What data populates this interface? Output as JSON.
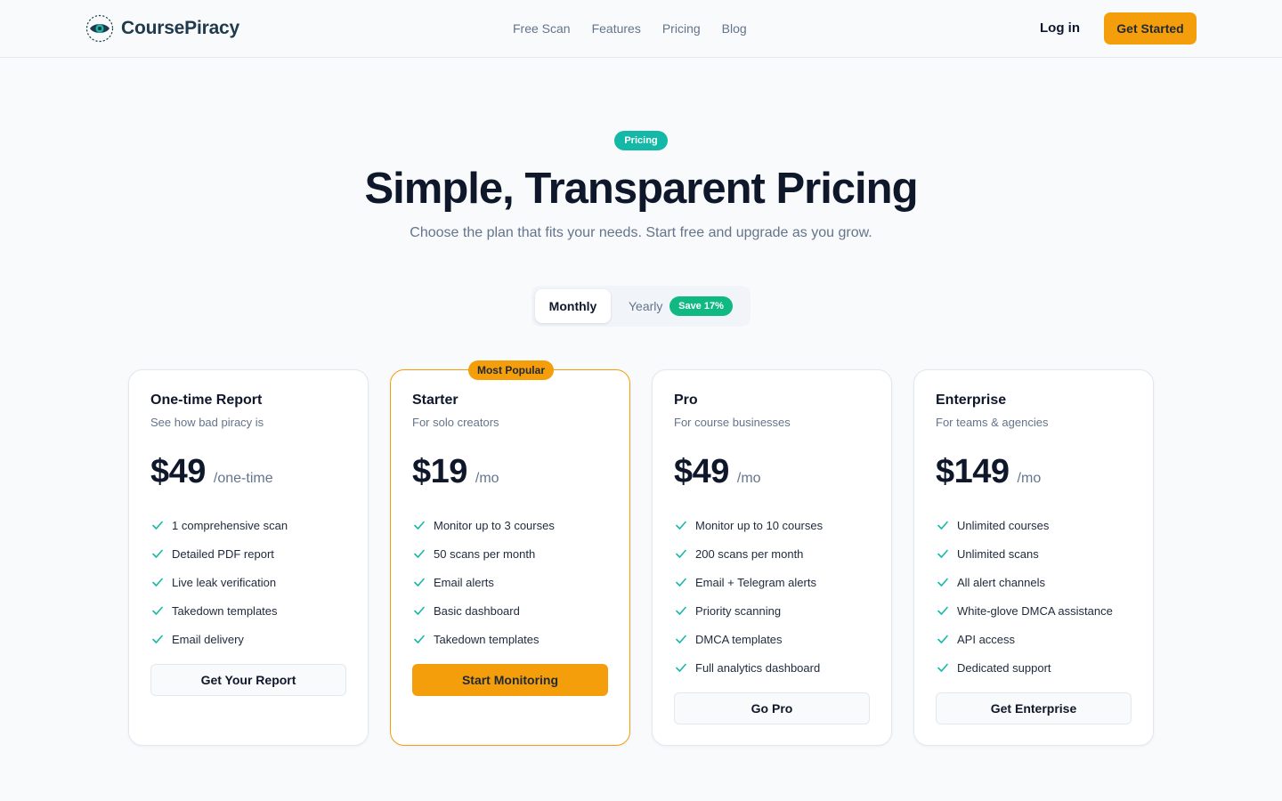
{
  "colors": {
    "accent": "#f59e0b",
    "teal": "#14b8a6",
    "success": "#10b981",
    "text": "#0f172a",
    "muted": "#64748b"
  },
  "header": {
    "brand": "CoursePiracy",
    "logo_icon": "eye-icon",
    "nav": [
      "Free Scan",
      "Features",
      "Pricing",
      "Blog"
    ],
    "login": "Log in",
    "cta": "Get Started"
  },
  "hero": {
    "pill": "Pricing",
    "title": "Simple, Transparent Pricing",
    "subtitle": "Choose the plan that fits your needs. Start free and upgrade as you grow."
  },
  "billing_toggle": {
    "monthly": "Monthly",
    "yearly": "Yearly",
    "badge": "Save 17%",
    "selected": "Monthly"
  },
  "plans": [
    {
      "name": "One-time Report",
      "desc": "See how bad piracy is",
      "price": "$49",
      "period": "/one-time",
      "features": [
        "1 comprehensive scan",
        "Detailed PDF report",
        "Live leak verification",
        "Takedown templates",
        "Email delivery"
      ],
      "button": "Get Your Report",
      "popular": false
    },
    {
      "name": "Starter",
      "desc": "For solo creators",
      "price": "$19",
      "period": "/mo",
      "features": [
        "Monitor up to 3 courses",
        "50 scans per month",
        "Email alerts",
        "Basic dashboard",
        "Takedown templates"
      ],
      "button": "Start Monitoring",
      "popular": true,
      "badge": "Most Popular"
    },
    {
      "name": "Pro",
      "desc": "For course businesses",
      "price": "$49",
      "period": "/mo",
      "features": [
        "Monitor up to 10 courses",
        "200 scans per month",
        "Email + Telegram alerts",
        "Priority scanning",
        "DMCA templates",
        "Full analytics dashboard"
      ],
      "button": "Go Pro",
      "popular": false
    },
    {
      "name": "Enterprise",
      "desc": "For teams & agencies",
      "price": "$149",
      "period": "/mo",
      "features": [
        "Unlimited courses",
        "Unlimited scans",
        "All alert channels",
        "White-glove DMCA assistance",
        "API access",
        "Dedicated support"
      ],
      "button": "Get Enterprise",
      "popular": false
    }
  ],
  "feature_icon": "check-icon"
}
